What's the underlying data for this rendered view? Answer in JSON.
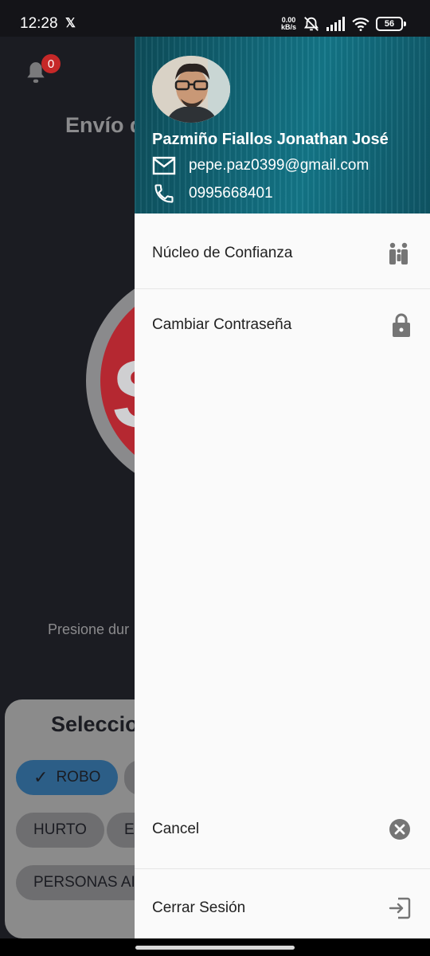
{
  "status_bar": {
    "time": "12:28",
    "speed_value": "0.00",
    "speed_unit": "kB/s",
    "battery": "56"
  },
  "background": {
    "notification_count": "0",
    "title": "Envío d",
    "sos_letter": "S",
    "hint": "Presione dur",
    "card_title": "Seleccio",
    "chips": [
      {
        "label": "ROBO",
        "selected": true
      },
      {
        "label": "HURTO",
        "selected": false
      },
      {
        "label": "E",
        "selected": false
      },
      {
        "label": "PERSONAS AI",
        "selected": false
      }
    ]
  },
  "drawer": {
    "user": {
      "name": "Pazmiño Fiallos Jonathan José",
      "email": "pepe.paz0399@gmail.com",
      "phone": "0995668401"
    },
    "menu": [
      {
        "label": "Núcleo de Confianza",
        "icon": "family-icon"
      },
      {
        "label": "Cambiar Contraseña",
        "icon": "lock-icon"
      }
    ],
    "footer": [
      {
        "label": "Cancel",
        "icon": "cancel-icon"
      },
      {
        "label": "Cerrar Sesión",
        "icon": "logout-icon"
      }
    ]
  },
  "colors": {
    "header_teal": "#12697a",
    "overlay_dark": "#1b1c22",
    "sos_red": "#b52831",
    "icon_gray": "#757575"
  }
}
